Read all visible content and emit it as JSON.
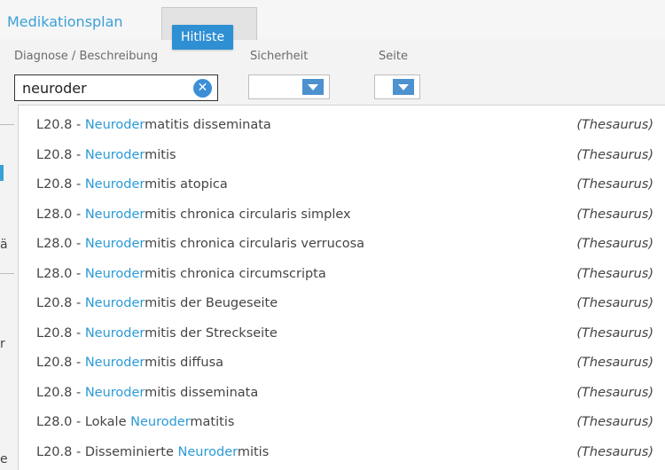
{
  "tabs": {
    "medikationsplan": "Medikationsplan",
    "hitlist_tooltip": "Hitliste"
  },
  "fields": {
    "diagnose_label": "Diagnose / Beschreibung",
    "sicherheit_label": "Sicherheit",
    "seite_label": "Seite",
    "search_value": "neuroder"
  },
  "background_left": {
    "items": [
      "ä",
      "r",
      "e"
    ]
  },
  "colors": {
    "accent_blue": "#2b9ad6",
    "tooltip_blue": "#2f8fd3",
    "select_arrow_blue": "#4d91cf"
  },
  "hitlist": [
    {
      "code": "L20.8",
      "pre": "",
      "hl": "Neuroder",
      "post": "matitis disseminata",
      "source": "(Thesaurus)"
    },
    {
      "code": "L20.8",
      "pre": "",
      "hl": "Neuroder",
      "post": "mitis",
      "source": "(Thesaurus)"
    },
    {
      "code": "L20.8",
      "pre": "",
      "hl": "Neuroder",
      "post": "mitis atopica",
      "source": "(Thesaurus)"
    },
    {
      "code": "L28.0",
      "pre": "",
      "hl": "Neuroder",
      "post": "mitis chronica circularis simplex",
      "source": "(Thesaurus)"
    },
    {
      "code": "L28.0",
      "pre": "",
      "hl": "Neuroder",
      "post": "mitis chronica circularis verrucosa",
      "source": "(Thesaurus)"
    },
    {
      "code": "L28.0",
      "pre": "",
      "hl": "Neuroder",
      "post": "mitis chronica circumscripta",
      "source": "(Thesaurus)"
    },
    {
      "code": "L20.8",
      "pre": "",
      "hl": "Neuroder",
      "post": "mitis der Beugeseite",
      "source": "(Thesaurus)"
    },
    {
      "code": "L20.8",
      "pre": "",
      "hl": "Neuroder",
      "post": "mitis der Streckseite",
      "source": "(Thesaurus)"
    },
    {
      "code": "L20.8",
      "pre": "",
      "hl": "Neuroder",
      "post": "mitis diffusa",
      "source": "(Thesaurus)"
    },
    {
      "code": "L20.8",
      "pre": "",
      "hl": "Neuroder",
      "post": "mitis disseminata",
      "source": "(Thesaurus)"
    },
    {
      "code": "L28.0",
      "pre": "Lokale ",
      "hl": "Neuroder",
      "post": "matitis",
      "source": "(Thesaurus)"
    },
    {
      "code": "L20.8",
      "pre": "Disseminierte ",
      "hl": "Neuroder",
      "post": "mitis",
      "source": "(Thesaurus)"
    }
  ]
}
